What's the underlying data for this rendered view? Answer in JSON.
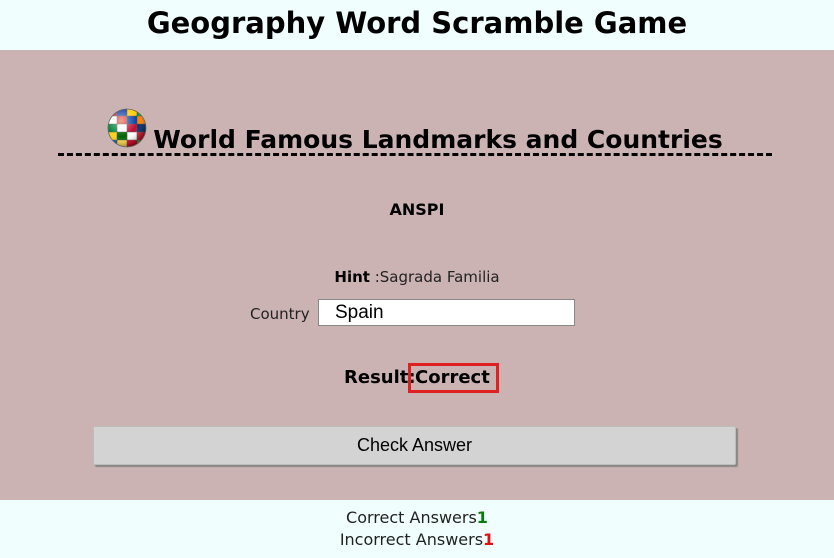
{
  "page": {
    "title": "Geography Word Scramble Game"
  },
  "category": {
    "title": "World Famous Landmarks and Countries",
    "icon": "globe-flags-icon"
  },
  "puzzle": {
    "scrambled_word": "ANSPI",
    "hint_label": "Hint",
    "hint_separator": " :",
    "hint_text": "Sagrada Familia"
  },
  "answer": {
    "label": "Country",
    "value": "Spain"
  },
  "result": {
    "label": "Result:",
    "value": "Correct"
  },
  "actions": {
    "check_label": "Check Answer"
  },
  "score": {
    "correct_label": "Correct Answers",
    "correct_count": "1",
    "incorrect_label": "Incorrect Answers",
    "incorrect_count": "1"
  },
  "colors": {
    "panel_background": "#ccb3b3",
    "page_background": "#f0fffe",
    "result_border": "#e02020",
    "correct_count": "#0a7a0a",
    "incorrect_count": "#e01010"
  }
}
